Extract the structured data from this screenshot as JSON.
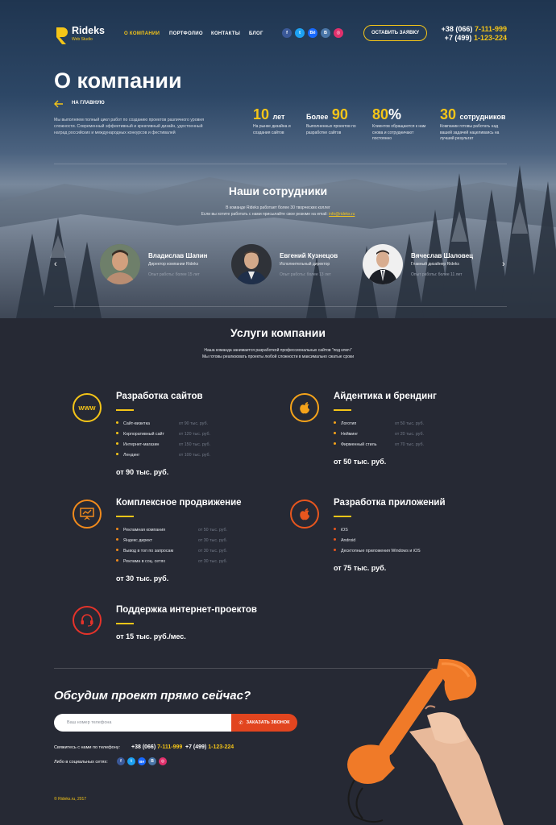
{
  "brand": {
    "name": "Rideks",
    "tagline": "Web Studio"
  },
  "nav": [
    {
      "label": "О компании",
      "active": true
    },
    {
      "label": "Портфолио",
      "active": false
    },
    {
      "label": "Контакты",
      "active": false
    },
    {
      "label": "Блог",
      "active": false
    }
  ],
  "social": [
    {
      "icon": "facebook-icon",
      "glyph": "f",
      "color": "#3b5998"
    },
    {
      "icon": "twitter-icon",
      "glyph": "t",
      "color": "#1da1f2"
    },
    {
      "icon": "behance-icon",
      "glyph": "Bē",
      "color": "#1769ff"
    },
    {
      "icon": "vk-icon",
      "glyph": "B",
      "color": "#4a76a8"
    },
    {
      "icon": "instagram-icon",
      "glyph": "◎",
      "color": "#e1306c"
    }
  ],
  "cta_button": "Оставить заявку",
  "phones": {
    "primary_prefix": "+38 (066)",
    "primary_number": "7-111-999",
    "secondary_prefix": "+7 (499)",
    "secondary_number": "1-123-224"
  },
  "hero": {
    "title": "О компании",
    "back_label": "На главную",
    "intro": "Мы выполняем полный цикл работ по созданию проектов различного уровня сложности. Современный эффективный и креативный дизайн, удостоенный наград российских и международных конкурсов и фестивалей"
  },
  "stats": [
    {
      "prefix": "",
      "value": "10",
      "suffix": "лет",
      "desc": "На рынке дизайна и создания сайтов"
    },
    {
      "prefix": "Более",
      "value": "90",
      "suffix": "",
      "desc": "Выполненных проектов по разработке сайтов"
    },
    {
      "prefix": "",
      "value": "80",
      "suffix": "%",
      "desc": "Клиентов обращаются к нам снова и сотрудничают постоянно"
    },
    {
      "prefix": "",
      "value": "30",
      "suffix": "сотрудников",
      "desc": "Компании готовы работать над вашей задачей нацеливаясь на лучший результат"
    }
  ],
  "team": {
    "title": "Наши сотрудники",
    "subtitle_line1": "В команде Rideks работает более 30 творческих коллег",
    "subtitle_line2": "Если вы хотите работать с нами присылайте свое резюме на email:",
    "email": "info@rideks.ru",
    "prev_arrow": "‹",
    "next_arrow": "›",
    "members": [
      {
        "name": "Владислав Шапин",
        "role": "Директор компании Rideks",
        "exp": "Опыт работы: более 15 лет"
      },
      {
        "name": "Евгений Кузнецов",
        "role": "Исполнительный директор",
        "exp": "Опыт работы: более 13 лет"
      },
      {
        "name": "Вячеслав Шаловец",
        "role": "Главный дизайнер Rideks",
        "exp": "Опыт работы: более 11 лет"
      }
    ]
  },
  "services": {
    "title": "Услуги компании",
    "subtitle_line1": "Наша команда занимается разработкой профессиональных сайтов \"под ключ\"",
    "subtitle_line2": "Мы готовы реализовать проекты любой сложности в максимально сжатые сроки",
    "items": [
      {
        "title": "Разработка сайтов",
        "icon": "www-icon",
        "icon_text": "WWW",
        "color": "#f5c518",
        "lines": [
          {
            "name": "Сайт-визитка",
            "price": "от 90 тыс. руб."
          },
          {
            "name": "Корпоративный сайт",
            "price": "от 120 тыс. руб."
          },
          {
            "name": "Интернет-магазин",
            "price": "от 150 тыс. руб."
          },
          {
            "name": "Лендинг",
            "price": "от 100 тыс. руб."
          }
        ],
        "price": "от 90 тыс. руб."
      },
      {
        "title": "Айдентика и брендинг",
        "icon": "apple-icon",
        "icon_text": "",
        "color": "#f5a31a",
        "lines": [
          {
            "name": "Логотип",
            "price": "от 50 тыс. руб."
          },
          {
            "name": "Нейминг",
            "price": "от 20 тыс. руб."
          },
          {
            "name": "Фирменный стиль",
            "price": "от 70 тыс. руб."
          }
        ],
        "price": "от 50 тыс. руб."
      },
      {
        "title": "Комплексное продвижение",
        "icon": "chart-board-icon",
        "icon_text": "",
        "color": "#f08a1c",
        "lines": [
          {
            "name": "Рекламная компания",
            "price": "от 50 тыс. руб."
          },
          {
            "name": "Яндекс директ",
            "price": "от 30 тыс. руб."
          },
          {
            "name": "Вывод в топ по запросам",
            "price": "от 30 тыс. руб."
          },
          {
            "name": "Реклама в соц. сетях",
            "price": "от 30 тыс. руб."
          }
        ],
        "price": "от 30 тыс. руб."
      },
      {
        "title": "Разработка приложений",
        "icon": "apple-icon",
        "icon_text": "",
        "color": "#e8561e",
        "lines": [
          {
            "name": "iOS",
            "price": ""
          },
          {
            "name": "Android",
            "price": ""
          },
          {
            "name": "Десктопные приложения Windows и iOS",
            "price": ""
          }
        ],
        "price": "от 75 тыс. руб."
      },
      {
        "title": "Поддержка интернет-проектов",
        "icon": "headset-icon",
        "icon_text": "",
        "color": "#e5332a",
        "lines": [],
        "price": "от 15 тыс. руб./мес."
      }
    ]
  },
  "contact": {
    "title": "Обсудим проект прямо сейчас?",
    "input_placeholder": "Ваш номер телефона",
    "button": "Заказать звонок",
    "phone_label": "Свяжитесь с нами по телефону:",
    "social_label": "Либо в социальных сетях:"
  },
  "footer": {
    "copyright": "© Rideks.ru, 2017"
  }
}
